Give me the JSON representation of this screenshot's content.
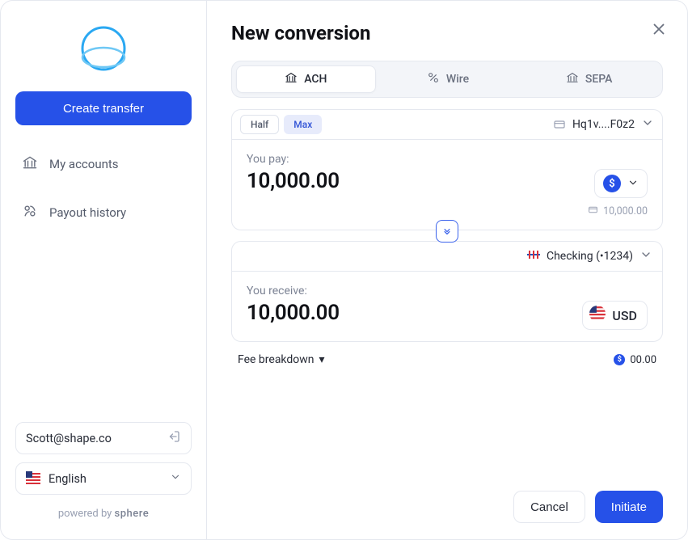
{
  "sidebar": {
    "create_button": "Create transfer",
    "nav": [
      {
        "label": "My accounts"
      },
      {
        "label": "Payout history"
      }
    ],
    "account_email": "Scott@shape.co",
    "language": "English",
    "powered_prefix": "powered by ",
    "powered_brand": "sphere"
  },
  "header": {
    "title": "New conversion"
  },
  "tabs": {
    "ach": "ACH",
    "wire": "Wire",
    "sepa": "SEPA"
  },
  "pay_card": {
    "half_label": "Half",
    "max_label": "Max",
    "source_account": "Hq1v....F0z2",
    "label": "You pay:",
    "amount": "10,000.00",
    "balance": "10,000.00"
  },
  "receive_card": {
    "dest_account": "Checking (•1234)",
    "label": "You receive:",
    "amount": "10,000.00",
    "currency": "USD"
  },
  "fee": {
    "breakdown_label": "Fee breakdown",
    "amount": "00.00"
  },
  "footer": {
    "cancel": "Cancel",
    "initiate": "Initiate"
  }
}
